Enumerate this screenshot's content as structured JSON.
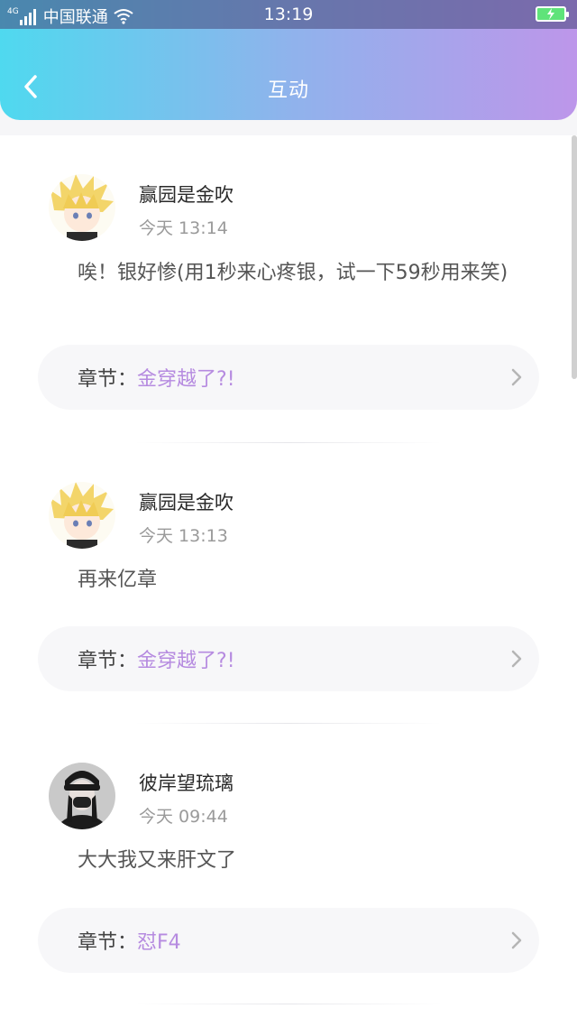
{
  "status_bar": {
    "network": "4G",
    "carrier": "中国联通",
    "time": "13:19"
  },
  "header": {
    "title": "互动",
    "back_icon": "chevron-left-icon",
    "gradient_colors": [
      "#4fd9ef",
      "#bd96ea"
    ]
  },
  "items": [
    {
      "username": "赢园是金吹",
      "time": "今天 13:14",
      "comment": "唉！银好惨(用1秒来心疼银，试一下59秒用来笑)",
      "chapter_label": "章节：",
      "chapter_name": "金穿越了?!"
    },
    {
      "username": "赢园是金吹",
      "time": "今天 13:13",
      "comment": "再来亿章",
      "chapter_label": "章节：",
      "chapter_name": "金穿越了?!"
    },
    {
      "username": "彼岸望琉璃",
      "time": "今天 09:44",
      "comment": "大大我又来肝文了",
      "chapter_label": "章节：",
      "chapter_name": "怼F4"
    }
  ],
  "colors": {
    "chapter_accent": "#b68be0"
  }
}
